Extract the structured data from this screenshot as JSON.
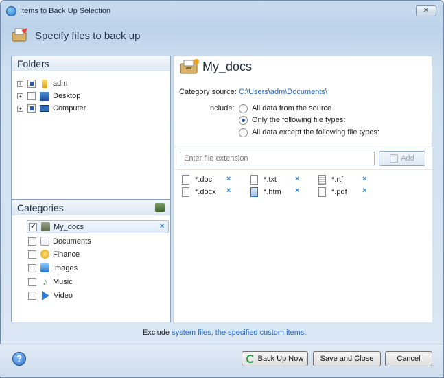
{
  "window": {
    "title": "Items to Back Up Selection",
    "close": "✕"
  },
  "header": {
    "title": "Specify files to back up"
  },
  "folders": {
    "title": "Folders",
    "items": [
      {
        "label": "adm",
        "state": "partial",
        "icon": "user-folder-icon"
      },
      {
        "label": "Desktop",
        "state": "unchecked",
        "icon": "desktop-folder-icon"
      },
      {
        "label": "Computer",
        "state": "partial",
        "icon": "computer-icon"
      }
    ]
  },
  "categories": {
    "title": "Categories",
    "items": [
      {
        "label": "My_docs",
        "checked": true,
        "icon": "my-docs-icon",
        "selected": true
      },
      {
        "label": "Documents",
        "checked": false,
        "icon": "documents-icon"
      },
      {
        "label": "Finance",
        "checked": false,
        "icon": "finance-icon"
      },
      {
        "label": "Images",
        "checked": false,
        "icon": "images-icon"
      },
      {
        "label": "Music",
        "checked": false,
        "icon": "music-icon"
      },
      {
        "label": "Video",
        "checked": false,
        "icon": "video-icon"
      }
    ],
    "remove_mark": "×"
  },
  "detail": {
    "name": "My_docs",
    "source_label": "Category source:",
    "source_value": "C:\\Users\\adm\\Documents\\",
    "include_label": "Include:",
    "options": [
      {
        "label": "All data from the source",
        "selected": false
      },
      {
        "label": "Only the following file types:",
        "selected": true
      },
      {
        "label": "All data except the following file types:",
        "selected": false
      }
    ],
    "extension_placeholder": "Enter file extension",
    "add_label": "Add",
    "file_types": [
      "*.doc",
      "*.txt",
      "*.rtf",
      "*.docx",
      "*.htm",
      "*.pdf"
    ],
    "remove_mark": "×"
  },
  "exclude": {
    "prefix": "Exclude",
    "link1": "system files,",
    "link2": "the specified custom items."
  },
  "footer": {
    "help": "?",
    "backup": "Back Up Now",
    "save": "Save and Close",
    "cancel": "Cancel"
  }
}
